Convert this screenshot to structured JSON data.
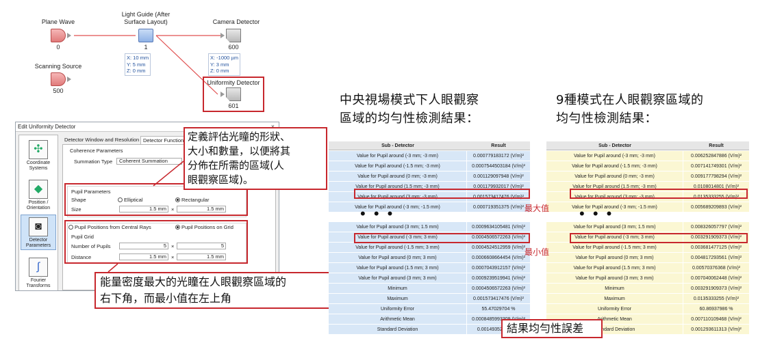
{
  "diagram": {
    "plane_wave": {
      "label": "Plane Wave",
      "num": "0"
    },
    "light_guide": {
      "label_line1": "Light Guide (After",
      "label_line2": "Surface Layout)",
      "num": "1"
    },
    "camera": {
      "label": "Camera Detector",
      "num": "600"
    },
    "scanning": {
      "label": "Scanning Source",
      "num": "500"
    },
    "uniformity": {
      "label": "Uniformity Detector",
      "num": "601"
    },
    "guide_coords": [
      "X: 10 mm",
      "Y: 5 mm",
      "Z: 0 mm"
    ],
    "camera_coords": [
      "X: -1000 µm",
      "Y: 3 mm",
      "Z: 0 mm"
    ],
    "colors": {
      "source": "#e07a7a",
      "guide": "#8fb2e6",
      "link": "#e05050",
      "highlight": "#c7272d"
    }
  },
  "dialog": {
    "title": "Edit Uniformity Detector",
    "close": "×",
    "sidebar": [
      {
        "label": "Coordinate Systems",
        "icon": "coordinate-icon"
      },
      {
        "label": "Position / Orientation",
        "icon": "position-icon"
      },
      {
        "label": "Detector Parameters",
        "icon": "detector-icon"
      },
      {
        "label": "Fourier Transforms",
        "icon": "fourier-icon"
      }
    ],
    "tabs": [
      "Detector Window and Resolution",
      "Detector Function"
    ],
    "coherence": {
      "title": "Coherence Parameters",
      "summation_label": "Summation Type",
      "summation_value": "Coherent Summation"
    },
    "pupil_params": {
      "title": "Pupil Parameters",
      "shape_label": "Shape",
      "elliptical": "Elliptical",
      "rectangular": "Rectangular",
      "size_label": "Size",
      "size_x": "1.5 mm",
      "size_y": "1.5 mm",
      "times": "×"
    },
    "positions": {
      "from_rays": "Pupil Positions from Central Rays",
      "on_grid": "Pupil Positions on Grid"
    },
    "pupil_grid": {
      "title": "Pupil Grid",
      "number_label": "Number of Pupils",
      "number_x": "5",
      "number_y": "5",
      "distance_label": "Distance",
      "distance_x": "1.5 mm",
      "distance_y": "1.5 mm",
      "times": "×"
    }
  },
  "callouts": {
    "define": [
      "定義評估光瞳的形狀、",
      "大小和數量，以便將其",
      "分佈在所需的區域(人",
      "眼觀察區域)。"
    ],
    "energy": [
      "能量密度最大的光瞳在人眼觀察區域的",
      "右下角，而最小值在左上角"
    ],
    "uniformity_error": "結果均勻性誤差"
  },
  "headings": {
    "left": [
      "中央視場模式下人眼觀察",
      "區域的均勻性檢測結果："
    ],
    "right": [
      "9種模式在人眼觀察區域的",
      "均勻性檢測結果："
    ]
  },
  "labels": {
    "max": "最大值",
    "min": "最小值",
    "dots": "• • •"
  },
  "table_left": {
    "headers": [
      "Sub - Detector",
      "Result"
    ],
    "top_rows": [
      [
        "Value for Pupil around (-3 mm; -3 mm)",
        "0.000779183172 (V/m)²"
      ],
      [
        "Value for Pupil around (-1.5 mm; -3 mm)",
        "0.0007544503184 (V/m)²"
      ],
      [
        "Value for Pupil around (0 mm; -3 mm)",
        "0.001129097948 (V/m)²"
      ],
      [
        "Value for Pupil around (1.5 mm; -3 mm)",
        "0.001179932017 (V/m)²"
      ],
      [
        "Value for Pupil around (3 mm; -3 mm)",
        "0.001573417476 (V/m)²"
      ],
      [
        "Value for Pupil around (-3 mm; -1.5 mm)",
        "0.000719351375 (V/m)²"
      ]
    ],
    "bottom_rows": [
      [
        "Value for Pupil around (3 mm; 1.5 mm)",
        "0.0009634105481 (V/m)²"
      ],
      [
        "Value for Pupil around (-3 mm; 3 mm)",
        "0.0004506572263 (V/m)²"
      ],
      [
        "Value for Pupil around (-1.5 mm; 3 mm)",
        "0.0004524512959 (V/m)²"
      ],
      [
        "Value for Pupil around (0 mm; 3 mm)",
        "0.0006608664454 (V/m)²"
      ],
      [
        "Value for Pupil around (1.5 mm; 3 mm)",
        "0.0007043912157 (V/m)²"
      ],
      [
        "Value for Pupil around (3 mm; 3 mm)",
        "0.0009239519941 (V/m)²"
      ],
      [
        "Minimum",
        "0.0004506572263 (V/m)²"
      ],
      [
        "Maximum",
        "0.001573417476 (V/m)²"
      ],
      [
        "Uniformity Error",
        "55.47029704 %"
      ],
      [
        "Arithmetic Mean",
        "0.0008485993309 (V/m)²"
      ],
      [
        "Standard Deviation",
        "0.001493521 (V/m)²"
      ]
    ]
  },
  "table_right": {
    "headers": [
      "Sub - Detector",
      "Result"
    ],
    "top_rows": [
      [
        "Value for Pupil around (-3 mm; -3 mm)",
        "0.006252847886 (V/m)²"
      ],
      [
        "Value for Pupil around (-1.5 mm; -3 mm)",
        "0.007141749301 (V/m)²"
      ],
      [
        "Value for Pupil around (0 mm; -3 mm)",
        "0.009177798294 (V/m)²"
      ],
      [
        "Value for Pupil around (1.5 mm; -3 mm)",
        "0.0108014801 (V/m)²"
      ],
      [
        "Value for Pupil around (3 mm; -3 mm)",
        "0.0135333255 (V/m)²"
      ],
      [
        "Value for Pupil around (-3 mm; -1.5 mm)",
        "0.005689209893 (V/m)²"
      ]
    ],
    "bottom_rows": [
      [
        "Value for Pupil around (3 mm; 1.5 mm)",
        "0.008326057797 (V/m)²"
      ],
      [
        "Value for Pupil around (-3 mm; 3 mm)",
        "0.003291909373 (V/m)²"
      ],
      [
        "Value for Pupil around (-1.5 mm; 3 mm)",
        "0.003681477125 (V/m)²"
      ],
      [
        "Value for Pupil around (0 mm; 3 mm)",
        "0.004817293561 (V/m)²"
      ],
      [
        "Value for Pupil around (1.5 mm; 3 mm)",
        "0.00570376368 (V/m)²"
      ],
      [
        "Value for Pupil around (3 mm; 3 mm)",
        "0.007040062448 (V/m)²"
      ],
      [
        "Minimum",
        "0.003291909373 (V/m)²"
      ],
      [
        "Maximum",
        "0.0135333255 (V/m)²"
      ],
      [
        "Uniformity Error",
        "60.86937986 %"
      ],
      [
        "Arithmetic Mean",
        "0.007110109468 (V/m)²"
      ],
      [
        "Standard Deviation",
        "0.001293611313 (V/m)²"
      ]
    ]
  }
}
